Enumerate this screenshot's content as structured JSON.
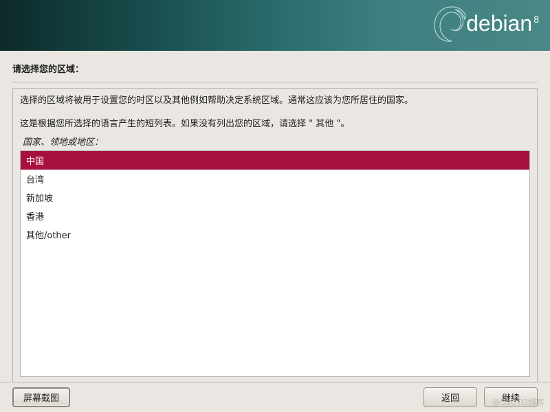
{
  "banner": {
    "brand": "debian",
    "version": "8"
  },
  "title": "请选择您的区域：",
  "desc1": "选择的区域将被用于设置您的时区以及其他例如帮助决定系统区域。通常这应该为您所居住的国家。",
  "desc2": "这是根据您所选择的语言产生的短列表。如果没有列出您的区域，请选择 \" 其他 \"。",
  "prompt": "国家、领地或地区：",
  "options": [
    {
      "label": "中国",
      "selected": true
    },
    {
      "label": "台湾",
      "selected": false
    },
    {
      "label": "新加坡",
      "selected": false
    },
    {
      "label": "香港",
      "selected": false
    },
    {
      "label": "其他/other",
      "selected": false
    }
  ],
  "buttons": {
    "screenshot": "屏幕截图",
    "back": "返回",
    "continue": "继续"
  },
  "watermark": "@51CTO博客"
}
